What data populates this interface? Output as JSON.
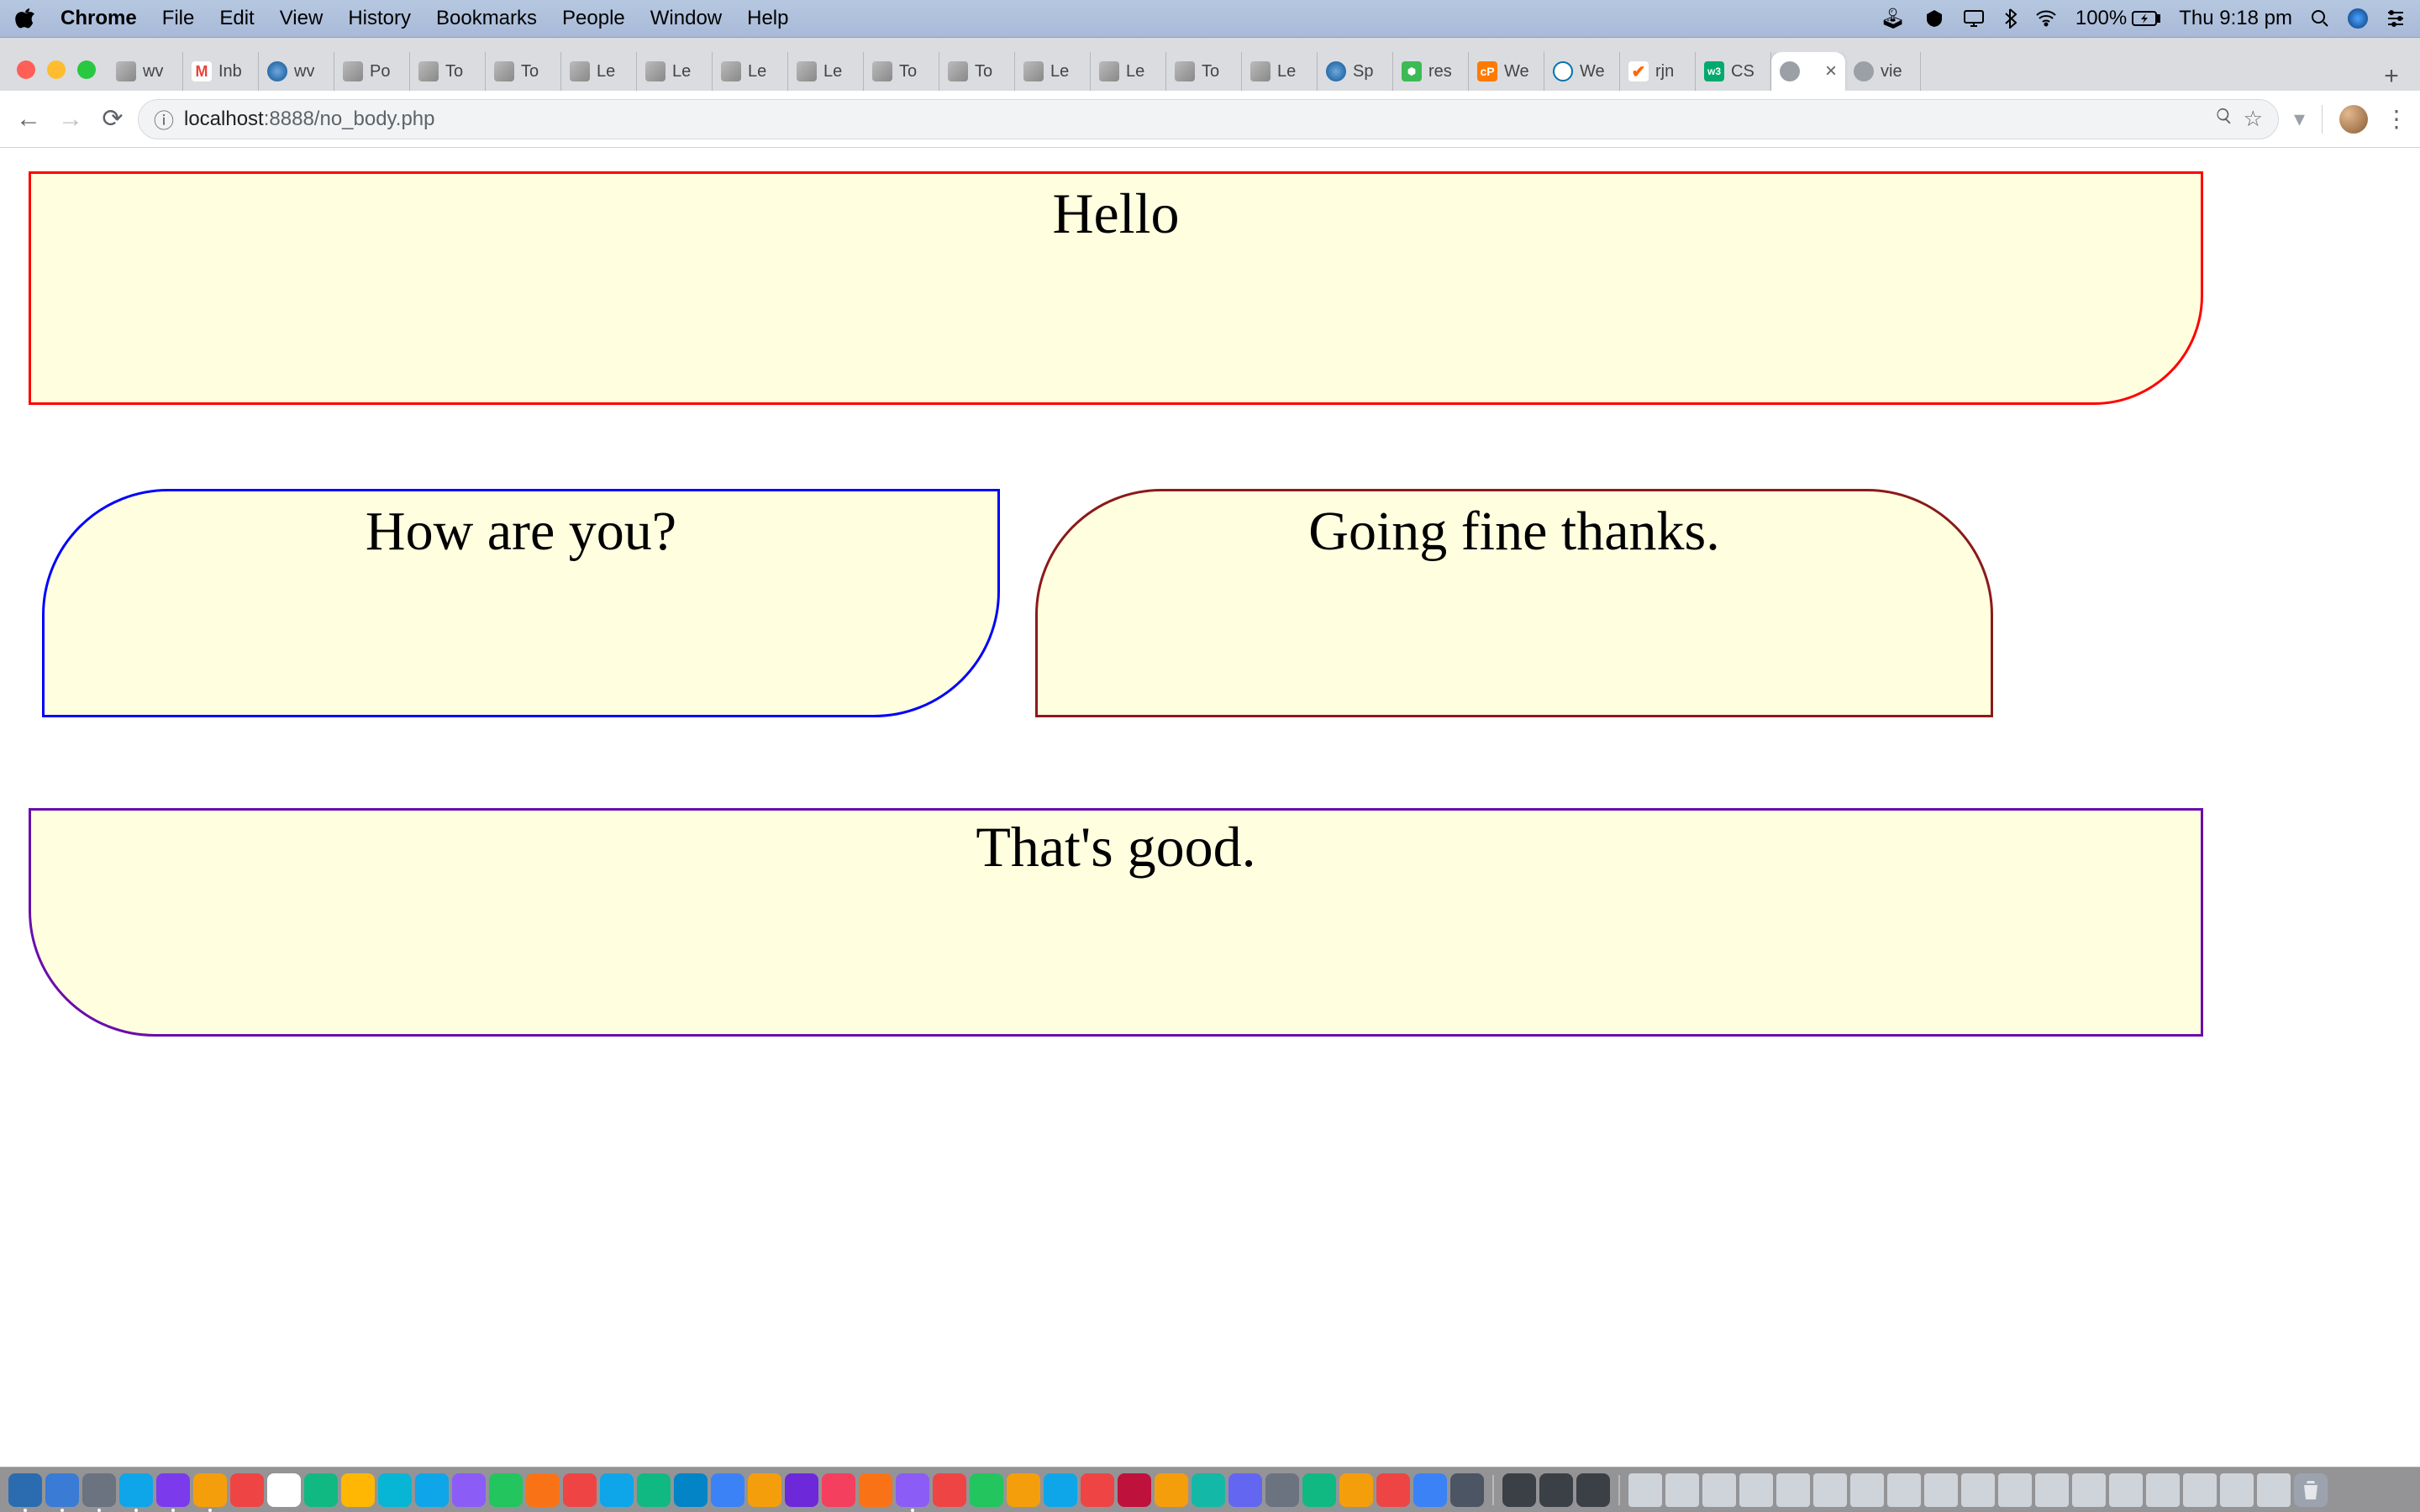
{
  "menubar": {
    "app": "Chrome",
    "items": [
      "File",
      "Edit",
      "View",
      "History",
      "Bookmarks",
      "People",
      "Window",
      "Help"
    ],
    "battery": "100%",
    "clock": "Thu 9:18 pm"
  },
  "tabs": [
    {
      "icon": "generic",
      "label": "wv"
    },
    {
      "icon": "gmail",
      "label": "Inb"
    },
    {
      "icon": "globe",
      "label": "wv"
    },
    {
      "icon": "generic",
      "label": "Po"
    },
    {
      "icon": "generic",
      "label": "To"
    },
    {
      "icon": "generic",
      "label": "To"
    },
    {
      "icon": "generic",
      "label": "Le"
    },
    {
      "icon": "generic",
      "label": "Le"
    },
    {
      "icon": "generic",
      "label": "Le"
    },
    {
      "icon": "generic",
      "label": "Le"
    },
    {
      "icon": "generic",
      "label": "To"
    },
    {
      "icon": "generic",
      "label": "To"
    },
    {
      "icon": "generic",
      "label": "Le"
    },
    {
      "icon": "generic",
      "label": "Le"
    },
    {
      "icon": "generic",
      "label": "To"
    },
    {
      "icon": "generic",
      "label": "Le"
    },
    {
      "icon": "globe",
      "label": "Sp"
    },
    {
      "icon": "ext",
      "label": "res"
    },
    {
      "icon": "cp",
      "label": "We"
    },
    {
      "icon": "wp",
      "label": "We"
    },
    {
      "icon": "tick",
      "label": "rjn"
    },
    {
      "icon": "w3",
      "label": "CS"
    },
    {
      "icon": "local",
      "label": "",
      "active": true,
      "close": "×"
    },
    {
      "icon": "local",
      "label": "vie"
    }
  ],
  "address": {
    "host": "localhost",
    "port": ":8888",
    "path": "/no_body.php"
  },
  "page": {
    "bubble1": "Hello",
    "bubble2": "How are you?",
    "bubble3": "Going fine thanks.",
    "bubble4": "That's good."
  },
  "dock_count": 52
}
